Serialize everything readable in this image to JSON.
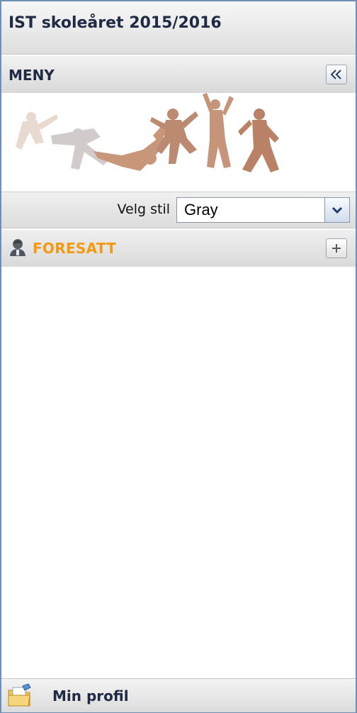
{
  "app": {
    "title": "IST skoleåret 2015/2016"
  },
  "menu": {
    "label": "MENY",
    "collapse_icon": "double-chevron-left-icon"
  },
  "banner": {
    "image": "jumping-children-silhouettes"
  },
  "style_selector": {
    "label": "Velg stil",
    "selected": "Gray",
    "arrow_icon": "chevron-down-icon"
  },
  "sections": [
    {
      "label": "FORESATT",
      "icon": "parent-person-icon",
      "toggle_icon": "plus-icon",
      "color": "#f39a12"
    }
  ],
  "footer": {
    "label": "Min profil",
    "icon": "profile-folder-icon"
  },
  "colors": {
    "frame_border": "#6e8fb8",
    "section_accent": "#f39a12",
    "header_text": "#1f2a44"
  }
}
